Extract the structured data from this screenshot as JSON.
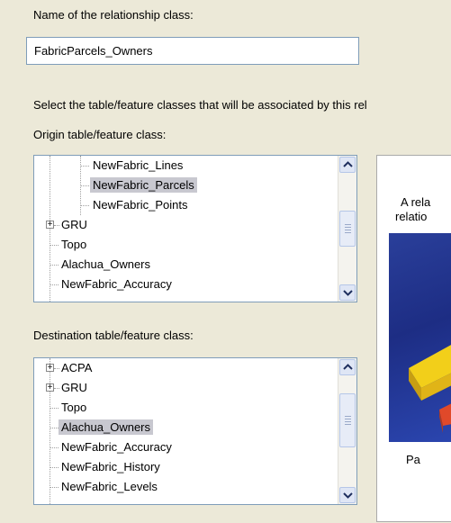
{
  "name_label": "Name of the relationship class:",
  "name_value": "FabricParcels_Owners",
  "select_instruction": "Select the table/feature classes that will be associated by this rel",
  "origin": {
    "label": "Origin table/feature class:",
    "items": [
      {
        "label": "NewFabric_Lines",
        "selected": false
      },
      {
        "label": "NewFabric_Parcels",
        "selected": true
      },
      {
        "label": "NewFabric_Points",
        "selected": false
      },
      {
        "label": "GRU",
        "selected": false,
        "expander": "+"
      },
      {
        "label": "Topo",
        "selected": false
      },
      {
        "label": "Alachua_Owners",
        "selected": false
      },
      {
        "label": "NewFabric_Accuracy",
        "selected": false
      }
    ]
  },
  "destination": {
    "label": "Destination table/feature class:",
    "items": [
      {
        "label": "ACPA",
        "selected": false,
        "expander": "+"
      },
      {
        "label": "GRU",
        "selected": false,
        "expander": "+"
      },
      {
        "label": "Topo",
        "selected": false
      },
      {
        "label": "Alachua_Owners",
        "selected": true
      },
      {
        "label": "NewFabric_Accuracy",
        "selected": false
      },
      {
        "label": "NewFabric_History",
        "selected": false
      },
      {
        "label": "NewFabric_Levels",
        "selected": false
      }
    ]
  },
  "info_panel": {
    "line1": "A rela",
    "line2": "relatio",
    "caption": "Pa"
  },
  "colors": {
    "window_bg": "#ece9d8",
    "selection_bg": "#c8c8d0",
    "field_border": "#7f9db9",
    "graphic_blue": "#1d2d84",
    "block_yellow": "#f2cf1a",
    "block_red": "#e0492a"
  }
}
